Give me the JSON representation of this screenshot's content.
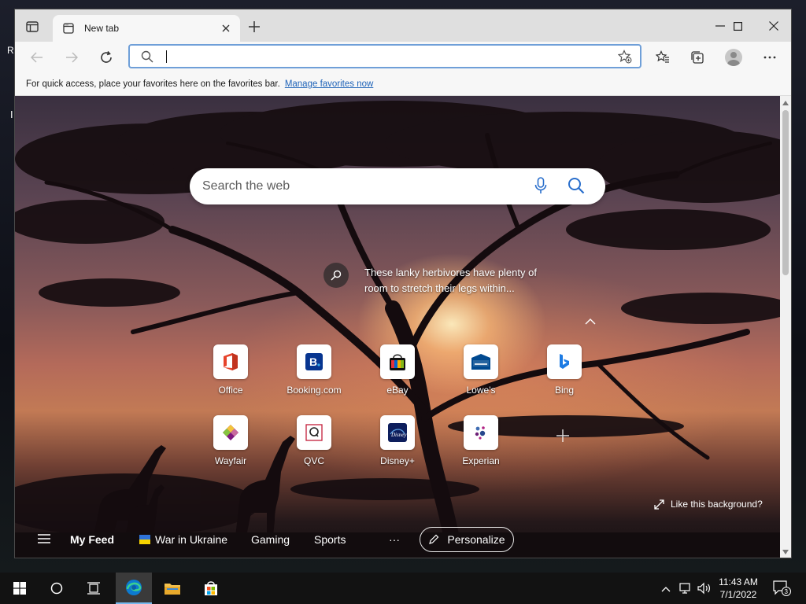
{
  "desktop": {
    "label_top": "R",
    "label_left": "I"
  },
  "browser": {
    "tab": {
      "title": "New tab"
    },
    "address": {
      "placeholder": "",
      "value": ""
    },
    "favorites_bar": {
      "message": "For quick access, place your favorites here on the favorites bar.",
      "link": "Manage favorites now"
    }
  },
  "newtab": {
    "search": {
      "placeholder": "Search the web"
    },
    "image_info": "These lanky herbivores have plenty of room to stretch their legs within...",
    "quick_links": [
      {
        "label": "Office",
        "icon": "office-icon"
      },
      {
        "label": "Booking.com",
        "icon": "booking-icon"
      },
      {
        "label": "eBay",
        "icon": "ebay-icon"
      },
      {
        "label": "Lowe's",
        "icon": "lowes-icon"
      },
      {
        "label": "Bing",
        "icon": "bing-icon"
      },
      {
        "label": "Wayfair",
        "icon": "wayfair-icon"
      },
      {
        "label": "QVC",
        "icon": "qvc-icon"
      },
      {
        "label": "Disney+",
        "icon": "disney-icon"
      },
      {
        "label": "Experian",
        "icon": "experian-icon"
      }
    ],
    "like_background": "Like this background?",
    "feed": {
      "my_feed": "My Feed",
      "items": [
        "War in Ukraine",
        "Gaming",
        "Sports"
      ],
      "more": "···",
      "personalize": "Personalize"
    }
  },
  "taskbar": {
    "time": "11:43 AM",
    "date": "7/1/2022",
    "notification_count": "3"
  },
  "colors": {
    "accent": "#1f63b8",
    "address_border": "#6f9fd8",
    "taskbar": "#121212"
  }
}
